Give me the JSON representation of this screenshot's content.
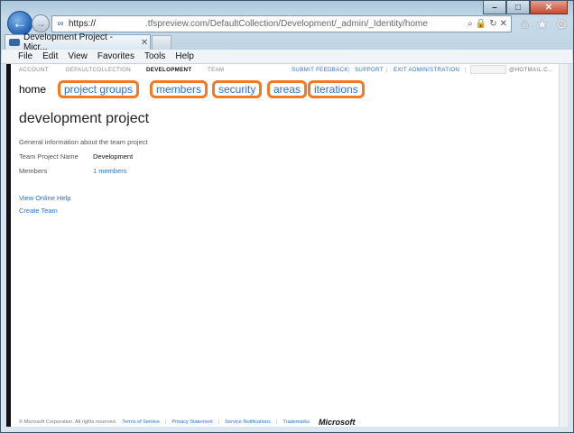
{
  "window": {
    "controls": {
      "minimize": "–",
      "maximize": "□",
      "close": "✕"
    }
  },
  "browser": {
    "address": {
      "scheme": "https://",
      "rest": ".tfspreview.com/DefaultCollection/Development/_admin/_Identity/home"
    },
    "tab": {
      "title": "Development Project - Micr...",
      "close": "✕"
    },
    "menu": [
      "File",
      "Edit",
      "View",
      "Favorites",
      "Tools",
      "Help"
    ]
  },
  "tfs": {
    "crumbs": {
      "account": "ACCOUNT",
      "collection": "DEFAULTCOLLECTION",
      "project": "DEVELOPMENT",
      "team": "TEAM"
    },
    "toplinks": {
      "feedback": "SUBMIT FEEDBACK",
      "support": "SUPPORT",
      "exit": "EXIT ADMINISTRATION"
    },
    "user": "@HOTMAIL.C...",
    "hubs": {
      "home": "home",
      "project_groups": "project groups",
      "members": "members",
      "security": "security",
      "areas": "areas",
      "iterations": "iterations"
    },
    "highlight_color": "#f47920"
  },
  "content": {
    "title": "development project",
    "subtitle": "General information about the team project",
    "rows": {
      "name_label": "Team Project Name",
      "name_value": "Development",
      "members_label": "Members",
      "members_value": "1 members"
    },
    "help_link": "View Online Help",
    "create_team": "Create Team"
  },
  "footer": {
    "copyright": "© Microsoft Corporation. All rights reserved.",
    "terms": "Terms of Service",
    "privacy": "Privacy Statement",
    "notifications": "Service Notifications",
    "trademarks": "Trademarks",
    "logo": "Microsoft"
  }
}
